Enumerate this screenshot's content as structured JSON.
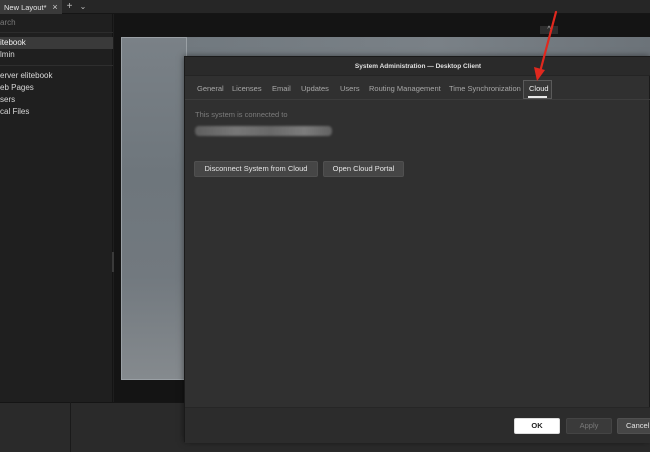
{
  "layout_tab": {
    "title": "New Layout*"
  },
  "icons": {
    "close": "×",
    "add": "+",
    "more": "⌄",
    "collapse": "‹",
    "scene_toggle": "^"
  },
  "sidebar": {
    "search_placeholder": "arch",
    "items": [
      {
        "label": "itebook",
        "selected": true
      },
      {
        "label": "lmin",
        "selected": false
      },
      {
        "label": "erver elitebook",
        "selected": false
      },
      {
        "label": "eb Pages",
        "selected": false
      },
      {
        "label": "sers",
        "selected": false
      },
      {
        "label": "cal Files",
        "selected": false
      }
    ]
  },
  "dialog": {
    "title": "System Administration — Desktop Client",
    "tabs": [
      {
        "label": "General"
      },
      {
        "label": "Licenses"
      },
      {
        "label": "Email"
      },
      {
        "label": "Updates"
      },
      {
        "label": "Users"
      },
      {
        "label": "Routing Management"
      },
      {
        "label": "Time Synchronization"
      },
      {
        "label": "Cloud",
        "active": true
      }
    ],
    "connected_label": "This system is connected to",
    "disconnect_button": "Disconnect System from Cloud",
    "portal_button": "Open Cloud Portal",
    "ok_button": "OK",
    "apply_button": "Apply",
    "cancel_button": "Cancel"
  },
  "colors": {
    "annotation_arrow": "#e0281e",
    "accent_tab_underline": "#e8e8e8"
  }
}
